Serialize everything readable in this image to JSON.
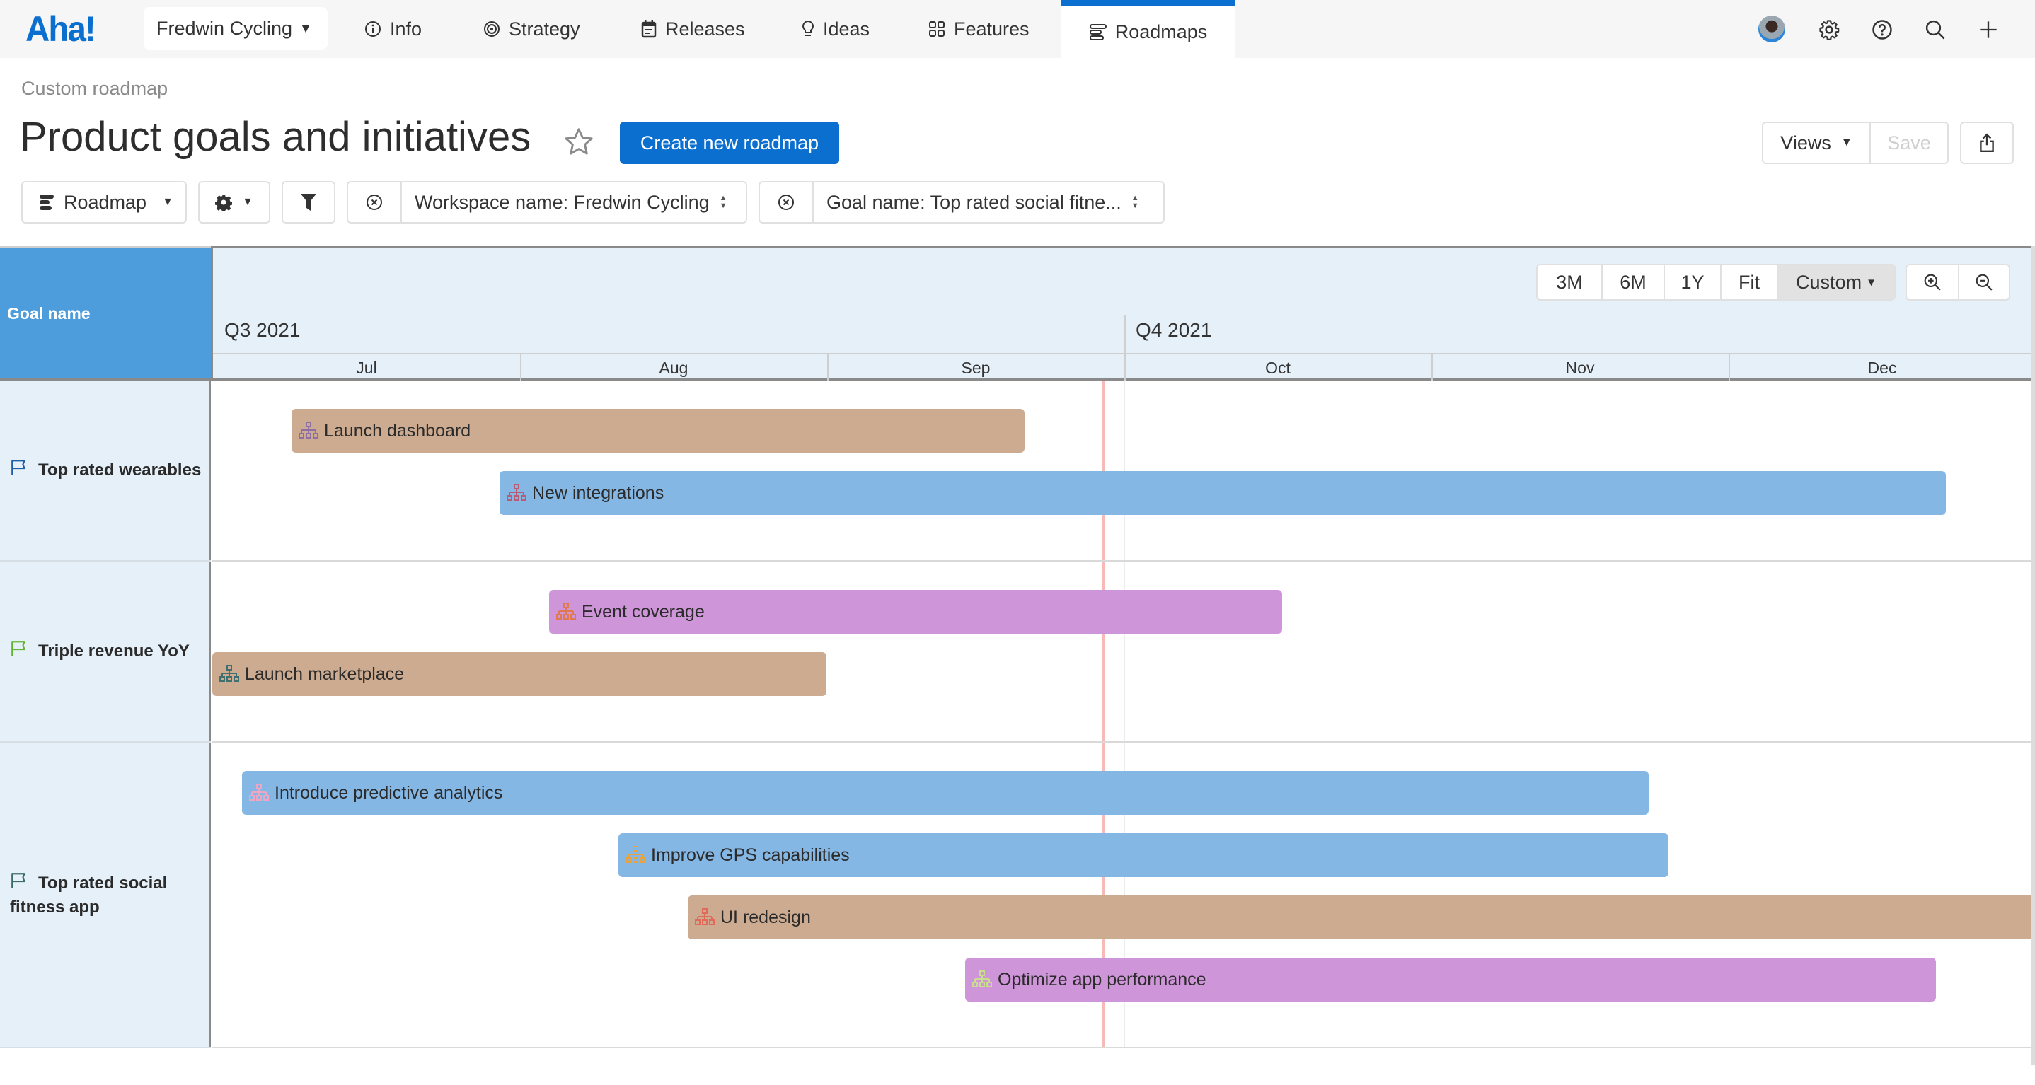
{
  "nav": {
    "logo": "Aha!",
    "workspace": "Fredwin Cycling",
    "items": [
      {
        "label": "Info",
        "icon": "info-icon"
      },
      {
        "label": "Strategy",
        "icon": "target-icon"
      },
      {
        "label": "Releases",
        "icon": "calendar-icon"
      },
      {
        "label": "Ideas",
        "icon": "lightbulb-icon"
      },
      {
        "label": "Features",
        "icon": "grid-icon"
      },
      {
        "label": "Roadmaps",
        "icon": "roadmap-icon",
        "active": true
      }
    ],
    "right_icons": [
      "avatar",
      "gear-icon",
      "help-icon",
      "search-icon",
      "plus-icon"
    ]
  },
  "header": {
    "breadcrumb": "Custom roadmap",
    "title": "Product goals and initiatives",
    "create_button": "Create new roadmap",
    "views_button": "Views",
    "save_button": "Save"
  },
  "toolbar": {
    "view_select": "Roadmap",
    "filters": [
      {
        "label": "Workspace name: Fredwin Cycling"
      },
      {
        "label": "Goal name: Top rated social fitne..."
      }
    ]
  },
  "timeline": {
    "column_header": "Goal name",
    "zoom_options": [
      "3M",
      "6M",
      "1Y",
      "Fit",
      "Custom"
    ],
    "zoom_selected": "Custom",
    "range_start": "2021-07-01",
    "range_end": "2021-12-31",
    "today": "2021-09-29",
    "quarters": [
      {
        "label": "Q3 2021",
        "start": "2021-07-01"
      },
      {
        "label": "Q4 2021",
        "start": "2021-10-01"
      }
    ],
    "months": [
      {
        "label": "Jul",
        "start": "2021-07-01",
        "end": "2021-07-31"
      },
      {
        "label": "Aug",
        "start": "2021-08-01",
        "end": "2021-08-31"
      },
      {
        "label": "Sep",
        "start": "2021-09-01",
        "end": "2021-09-30"
      },
      {
        "label": "Oct",
        "start": "2021-10-01",
        "end": "2021-10-31"
      },
      {
        "label": "Nov",
        "start": "2021-11-01",
        "end": "2021-11-30"
      },
      {
        "label": "Dec",
        "start": "2021-12-01",
        "end": "2021-12-31"
      }
    ],
    "colors": {
      "tan": "#cdab90",
      "blue": "#85b7e5",
      "purple": "#cf95d9"
    },
    "goals": [
      {
        "name": "Top rated wearables",
        "flag_color": "#1f5fa8",
        "initiatives": [
          {
            "name": "Launch dashboard",
            "start": "2021-07-09",
            "end": "2021-09-20",
            "color": "#cdab90",
            "icon_color": "#8d6fa6"
          },
          {
            "name": "New integrations",
            "start": "2021-07-30",
            "end": "2021-12-22",
            "color": "#85b7e5",
            "icon_color": "#b95b74"
          }
        ]
      },
      {
        "name": "Triple revenue YoY",
        "flag_color": "#62b52f",
        "initiatives": [
          {
            "name": "Event coverage",
            "start": "2021-08-04",
            "end": "2021-10-16",
            "color": "#cf95d9",
            "icon_color": "#e07a4e"
          },
          {
            "name": "Launch marketplace",
            "start": "2021-07-01",
            "end": "2021-08-31",
            "color": "#cdab90",
            "icon_color": "#3f6f6f"
          }
        ]
      },
      {
        "name": "Top rated social fitness app",
        "flag_color": "#3d6b6b",
        "initiatives": [
          {
            "name": "Introduce predictive analytics",
            "start": "2021-07-04",
            "end": "2021-11-22",
            "color": "#85b7e5",
            "icon_color": "#f0a5c2"
          },
          {
            "name": "Improve GPS capabilities",
            "start": "2021-08-11",
            "end": "2021-11-24",
            "color": "#85b7e5",
            "icon_color": "#eda13a"
          },
          {
            "name": "UI redesign",
            "start": "2021-08-18",
            "end": "2022-01-15",
            "color": "#cdab90",
            "icon_color": "#e06a5a"
          },
          {
            "name": "Optimize app performance",
            "start": "2021-09-15",
            "end": "2021-12-21",
            "color": "#cf95d9",
            "icon_color": "#c9dd8e"
          }
        ]
      }
    ]
  }
}
